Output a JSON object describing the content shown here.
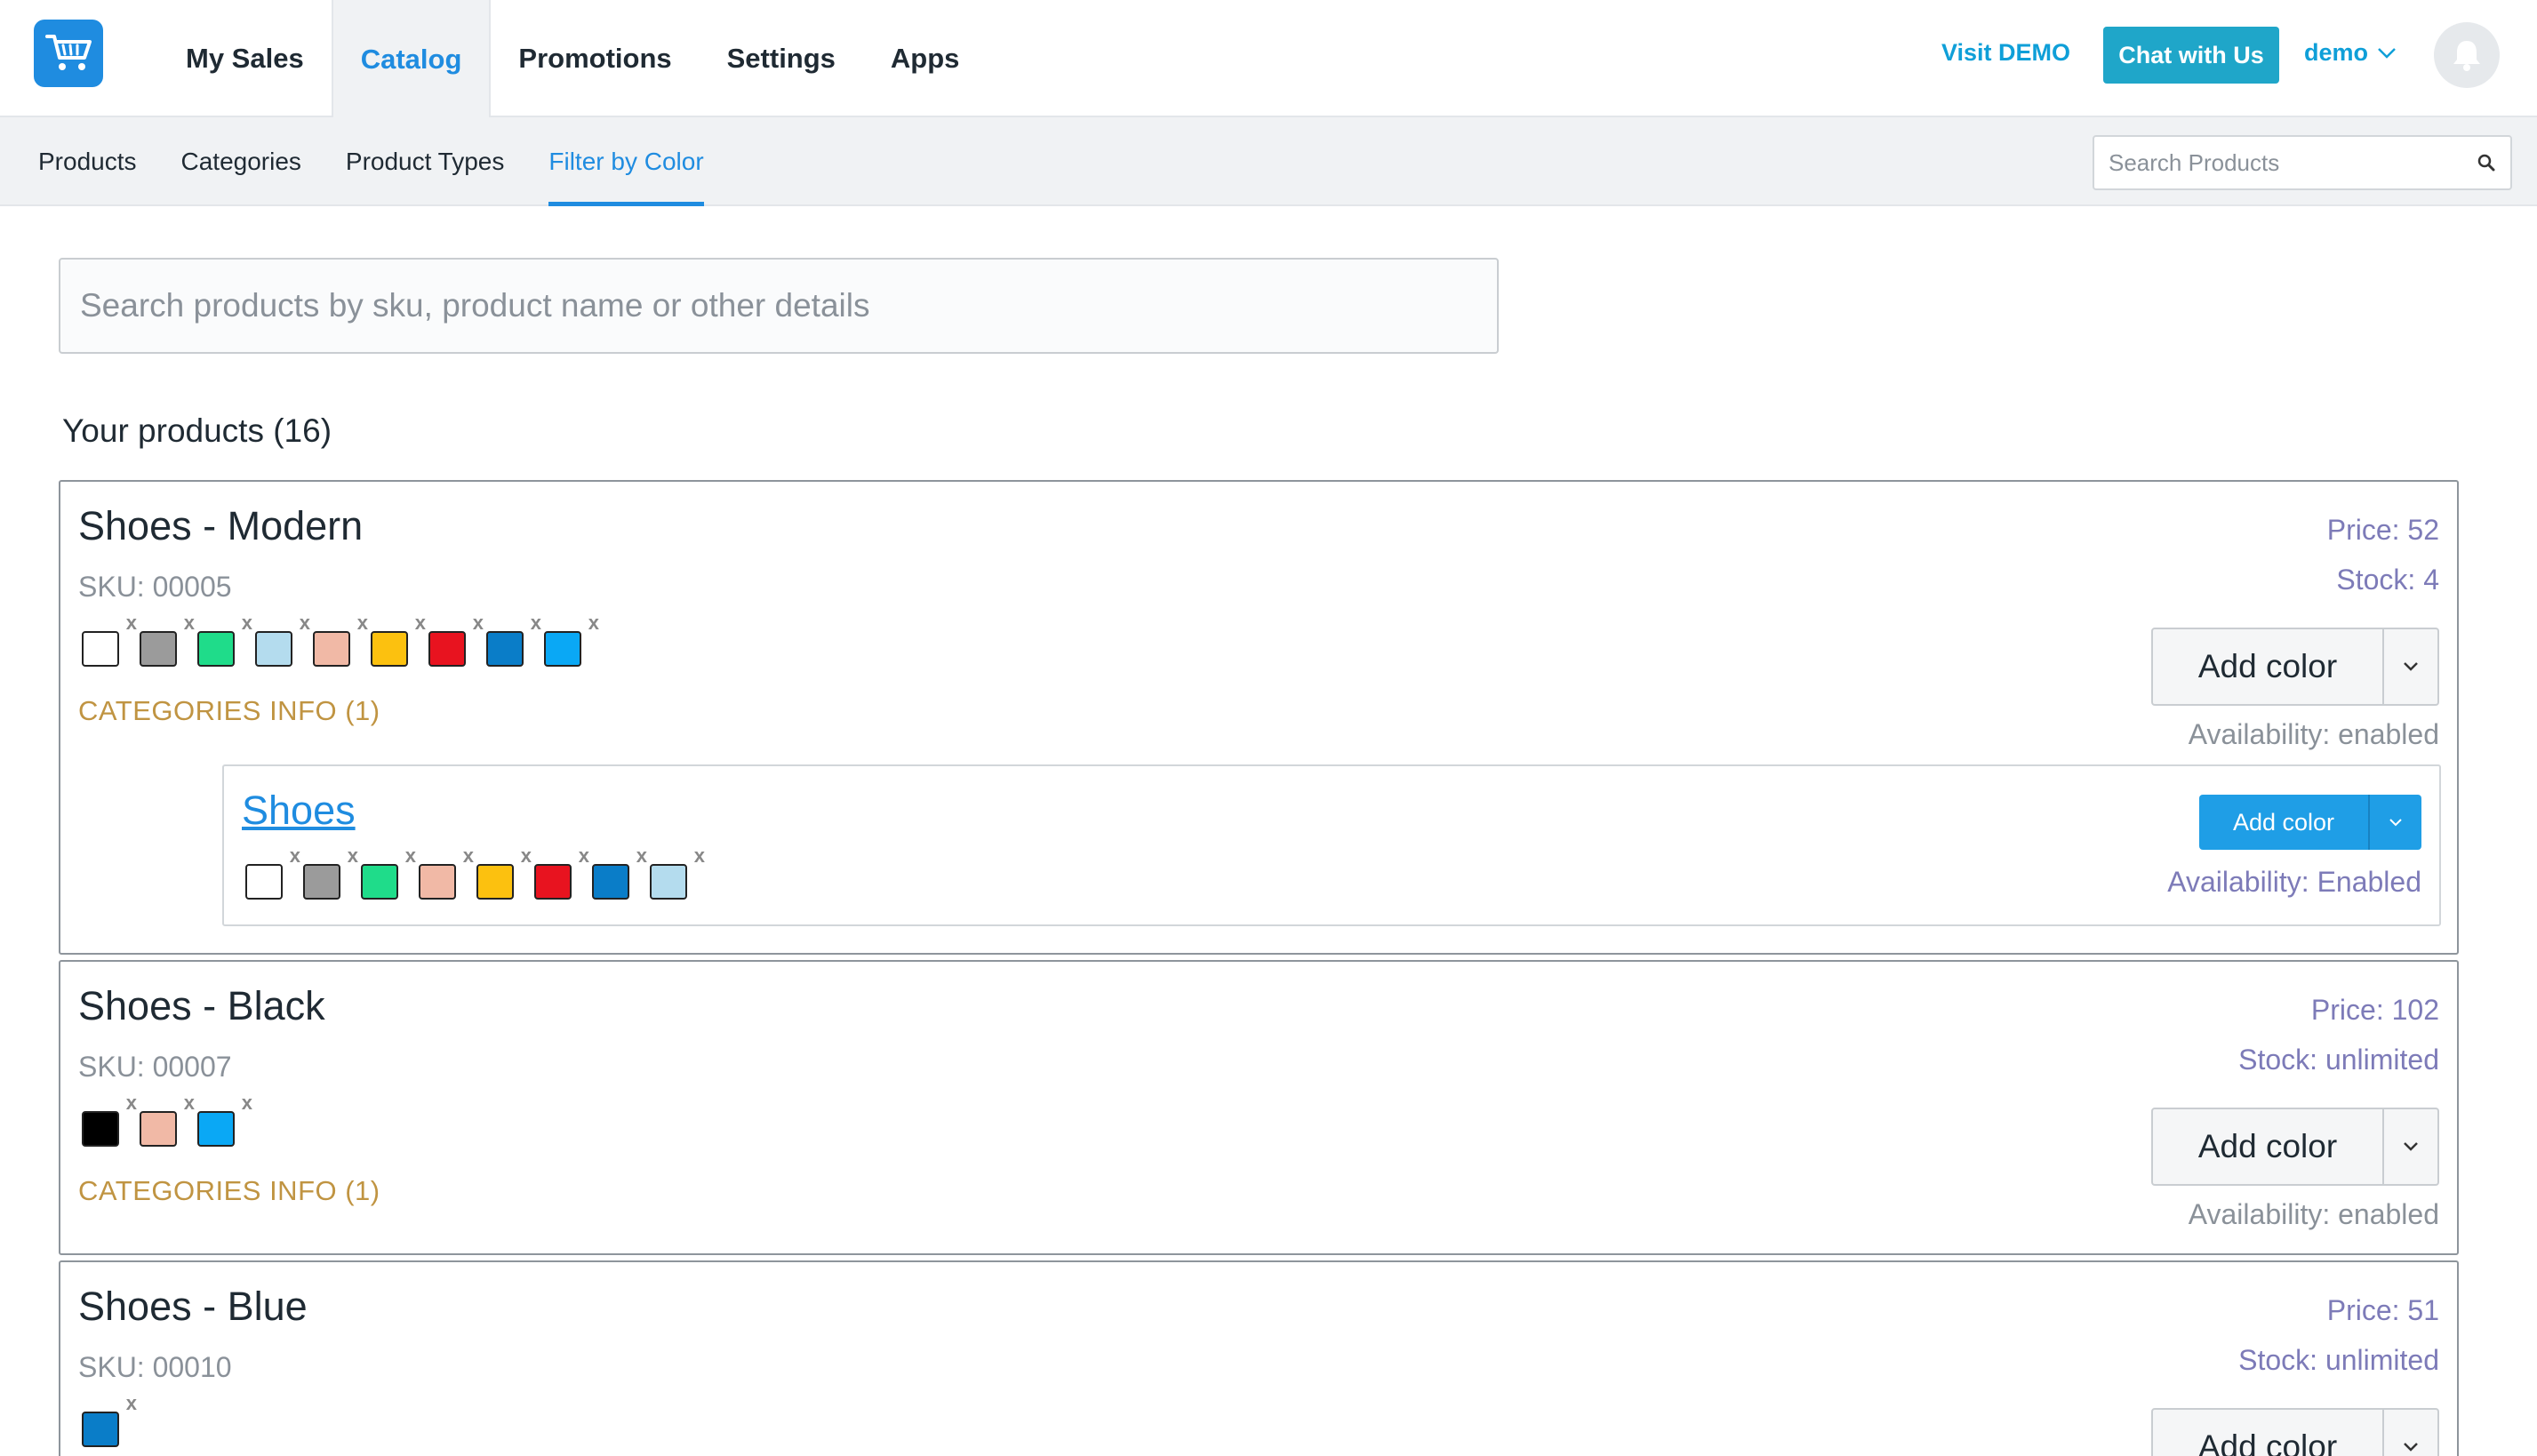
{
  "header": {
    "nav": [
      "My Sales",
      "Catalog",
      "Promotions",
      "Settings",
      "Apps"
    ],
    "active_nav": "Catalog",
    "visit_demo": "Visit DEMO",
    "chat": "Chat with Us",
    "user": "demo"
  },
  "subnav": {
    "items": [
      "Products",
      "Categories",
      "Product Types",
      "Filter by Color"
    ],
    "active": "Filter by Color",
    "search_placeholder": "Search Products"
  },
  "main": {
    "search_placeholder": "Search products by sku, product name or other details",
    "products_count": "Your products (16)"
  },
  "colors": {
    "white": "#ffffff",
    "gray": "#9b9b9b",
    "green": "#1fdc8a",
    "light-blue": "#b4dcee",
    "peach": "#f1b9a6",
    "yellow": "#fcc10f",
    "red": "#e8131f",
    "blue": "#0a7dc8",
    "sky-blue": "#0aa8f5",
    "black": "#000000"
  },
  "products": [
    {
      "name": "Shoes - Modern",
      "sku": "SKU: 00005",
      "swatches": [
        "white",
        "gray",
        "green",
        "light-blue",
        "peach",
        "yellow",
        "red",
        "blue",
        "sky-blue"
      ],
      "categories_info": "CATEGORIES INFO (1)",
      "price": "Price: 52",
      "stock": "Stock: 4",
      "add_color": "Add color",
      "availability": "Availability: enabled",
      "category": {
        "name": "Shoes",
        "swatches": [
          "white",
          "gray",
          "green",
          "peach",
          "yellow",
          "red",
          "blue",
          "light-blue"
        ],
        "add_color": "Add color",
        "availability": "Availability: Enabled"
      }
    },
    {
      "name": "Shoes - Black",
      "sku": "SKU: 00007",
      "swatches": [
        "black",
        "peach",
        "sky-blue"
      ],
      "categories_info": "CATEGORIES INFO (1)",
      "price": "Price: 102",
      "stock": "Stock: unlimited",
      "add_color": "Add color",
      "availability": "Availability: enabled"
    },
    {
      "name": "Shoes - Blue",
      "sku": "SKU: 00010",
      "swatches": [
        "blue"
      ],
      "price": "Price: 51",
      "stock": "Stock: unlimited",
      "add_color": "Add color"
    }
  ]
}
